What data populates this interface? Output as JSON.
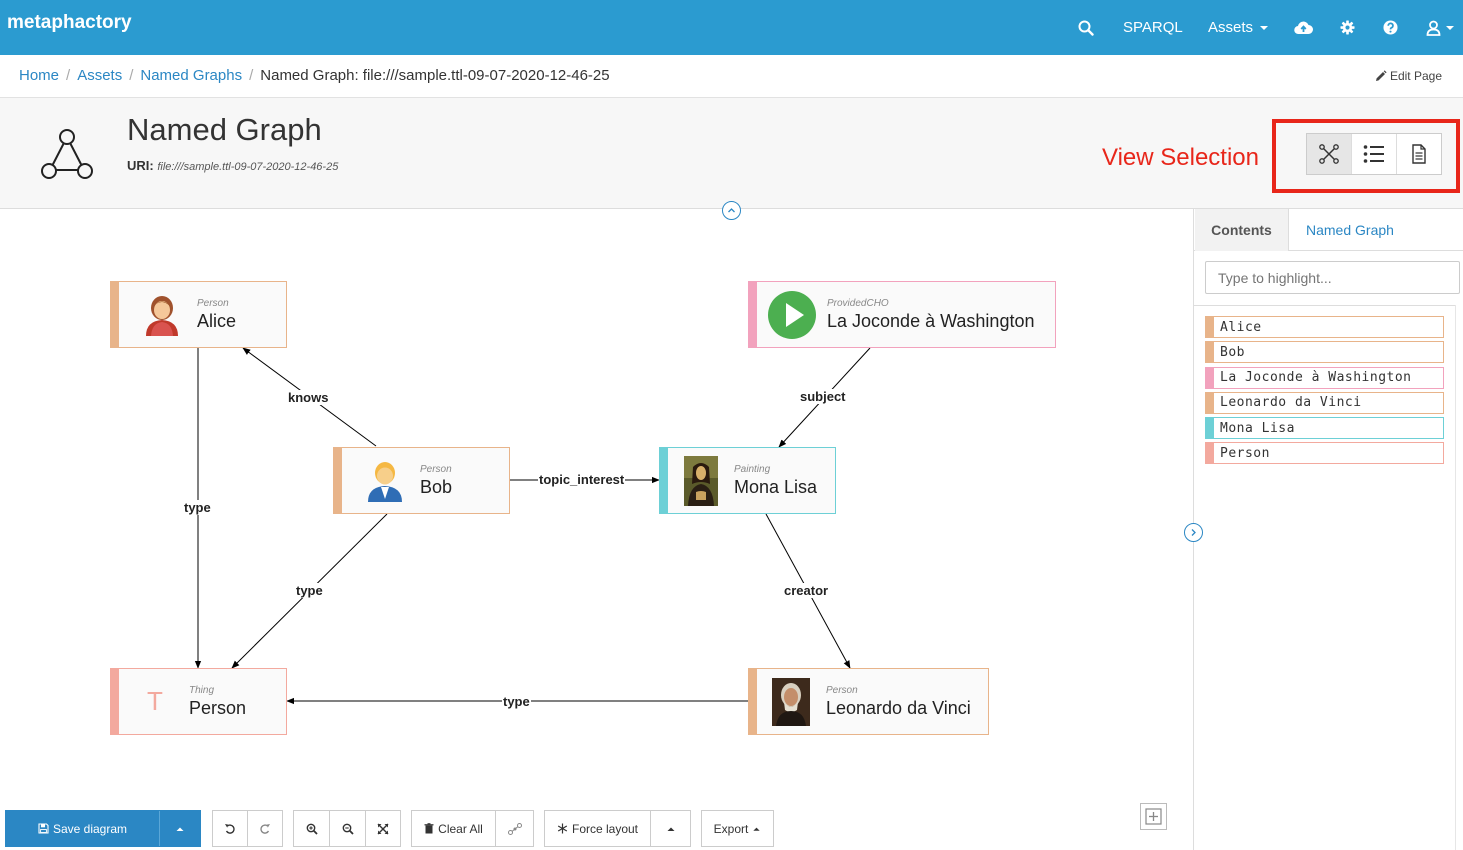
{
  "navbar": {
    "brand": "metaphactory",
    "sparql_label": "SPARQL",
    "assets_label": "Assets",
    "color": "#2b9bd0"
  },
  "breadcrumb": {
    "items": [
      "Home",
      "Assets",
      "Named Graphs"
    ],
    "current": "Named Graph: file:///sample.ttl-09-07-2020-12-46-25",
    "edit_label": "Edit Page"
  },
  "page": {
    "title": "Named Graph",
    "uri_label": "URI:",
    "uri_value": "file:///sample.ttl-09-07-2020-12-46-25",
    "view_selection_label": "View Selection",
    "view_buttons": [
      "graph-view-icon",
      "list-view-icon",
      "document-view-icon"
    ]
  },
  "diagram": {
    "nodes": {
      "alice": {
        "type": "Person",
        "label": "Alice",
        "icon": "female-person-icon"
      },
      "bob": {
        "type": "Person",
        "label": "Bob",
        "icon": "male-person-icon"
      },
      "joconde": {
        "type": "ProvidedCHO",
        "label": "La Joconde à Washington",
        "icon": "play-icon"
      },
      "mona": {
        "type": "Painting",
        "label": "Mona Lisa",
        "icon": "painting-thumbnail"
      },
      "person": {
        "type": "Thing",
        "label": "Person",
        "glyph": "T"
      },
      "leonardo": {
        "type": "Person",
        "label": "Leonardo da Vinci",
        "icon": "portrait-thumbnail"
      }
    },
    "edges": {
      "knows": "knows",
      "subject": "subject",
      "topic_interest": "topic_interest",
      "type_alice": "type",
      "type_bob": "type",
      "creator": "creator",
      "type_leonardo": "type"
    }
  },
  "toolbar": {
    "save_label": "Save diagram",
    "clear_label": "Clear All",
    "layout_label": "Force layout",
    "export_label": "Export"
  },
  "panel": {
    "tabs": [
      "Contents",
      "Named Graph"
    ],
    "search_placeholder": "Type to highlight...",
    "items": [
      "Alice",
      "Bob",
      "La Joconde à Washington",
      "Leonardo da Vinci",
      "Mona Lisa",
      "Person"
    ]
  },
  "colors": {
    "person": "#e8b48a",
    "provided_cho": "#f2a2bd",
    "painting": "#6dd0d6",
    "thing": "#f3a99e",
    "highlight_red": "#e8261a",
    "link_blue": "#2b87c4"
  }
}
